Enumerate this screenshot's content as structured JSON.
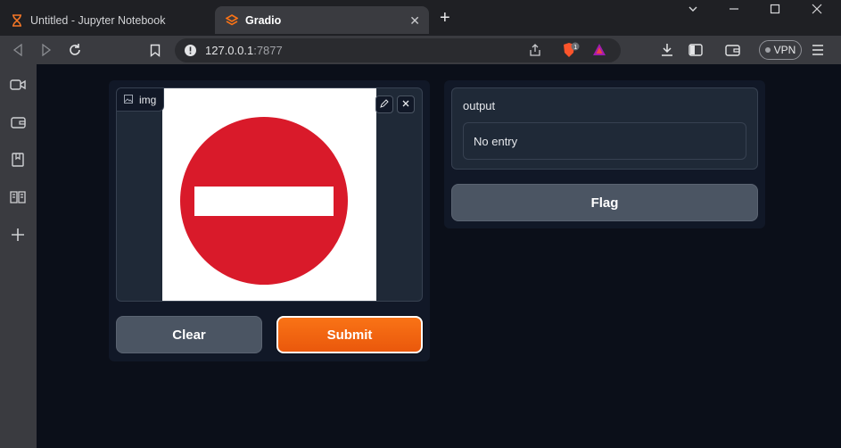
{
  "browser": {
    "tabs": [
      {
        "label": "Untitled - Jupyter Notebook",
        "icon": "hourglass-icon",
        "active": false
      },
      {
        "label": "Gradio",
        "icon": "gradio-logo-icon",
        "active": true
      }
    ],
    "url_host": "127.0.0.1",
    "url_port": ":7877",
    "vpn_label": "VPN",
    "shield_badge": "1"
  },
  "app": {
    "input_label": "img",
    "output_label": "output",
    "output_value": "No entry",
    "clear_label": "Clear",
    "submit_label": "Submit",
    "flag_label": "Flag"
  },
  "colors": {
    "page_bg": "#0b0f19",
    "submit_orange": "#f97316",
    "sign_red": "#d91a2a"
  }
}
